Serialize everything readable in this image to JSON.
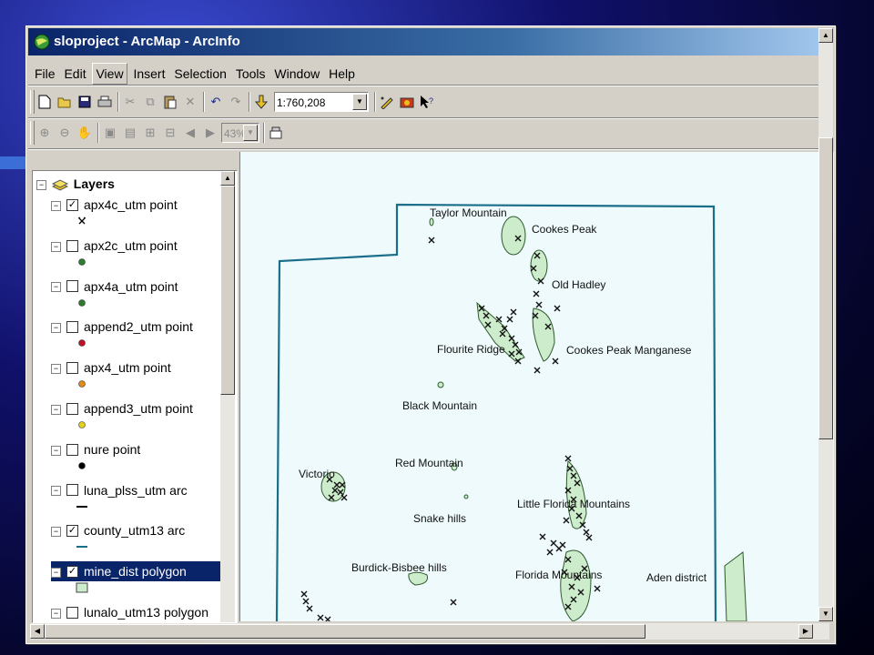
{
  "window": {
    "title": "sloproject - ArcMap - ArcInfo"
  },
  "menu": [
    "File",
    "Edit",
    "View",
    "Insert",
    "Selection",
    "Tools",
    "Window",
    "Help"
  ],
  "menu_active": "View",
  "toolbar_standard": {
    "buttons": [
      "new-icon",
      "open-icon",
      "save-icon",
      "print-icon",
      "cut-icon",
      "copy-icon",
      "paste-icon",
      "delete-icon",
      "undo-icon",
      "redo-icon",
      "add-data-icon"
    ],
    "scale_value": "1:760,208",
    "extra_buttons": [
      "editor-icon",
      "arctoolbox-icon",
      "whats-this-icon"
    ]
  },
  "toolbar_layout": {
    "buttons": [
      "zoom-in-page-icon",
      "zoom-out-page-icon",
      "pan-page-icon",
      "zoom-whole-page-icon",
      "zoom-100-icon",
      "fixed-zoom-in-icon",
      "fixed-zoom-out-icon",
      "back-extent-icon",
      "forward-extent-icon"
    ],
    "zoom_value": "43%",
    "extra_button": "toggle-draft-icon"
  },
  "toc": {
    "root_label": "Layers",
    "layers": [
      {
        "name": "apx4c_utm point",
        "checked": true,
        "symbol": "mine-x",
        "symbol_color": "#000000"
      },
      {
        "name": "apx2c_utm point",
        "checked": false,
        "symbol": "dot",
        "symbol_color": "#2e7d2e"
      },
      {
        "name": "apx4a_utm point",
        "checked": false,
        "symbol": "dot",
        "symbol_color": "#2e7d2e"
      },
      {
        "name": "append2_utm point",
        "checked": false,
        "symbol": "dot",
        "symbol_color": "#c0102a"
      },
      {
        "name": "apx4_utm point",
        "checked": false,
        "symbol": "dot",
        "symbol_color": "#e08a1a"
      },
      {
        "name": "append3_utm point",
        "checked": false,
        "symbol": "dot",
        "symbol_color": "#e2d21a"
      },
      {
        "name": "nure point",
        "checked": false,
        "symbol": "dot",
        "symbol_color": "#000000"
      },
      {
        "name": "luna_plss_utm arc",
        "checked": false,
        "symbol": "line",
        "symbol_color": "#000000"
      },
      {
        "name": "county_utm13 arc",
        "checked": true,
        "symbol": "line",
        "symbol_color": "#1a6e8a"
      },
      {
        "name": "mine_dist polygon",
        "checked": true,
        "symbol": "box",
        "symbol_color": "#cdeccb",
        "selected": true
      },
      {
        "name": "lunalo_utm13 polygon",
        "checked": false,
        "symbol": "box",
        "symbol_color": "#ffffff"
      }
    ]
  },
  "map": {
    "labels": [
      "Taylor Mountain",
      "Cookes Peak",
      "Old Hadley",
      "Flourite Ridge",
      "Cookes Peak Manganese",
      "Black Mountain",
      "Red Mountain",
      "Victorio",
      "Little Florida Mountains",
      "Snake hills",
      "Burdick-Bisbee hills",
      "Florida Mountains",
      "Aden district"
    ],
    "boundary_color": "#1a6e8a",
    "district_fill": "#cdeccb",
    "background": "#eefafb"
  }
}
